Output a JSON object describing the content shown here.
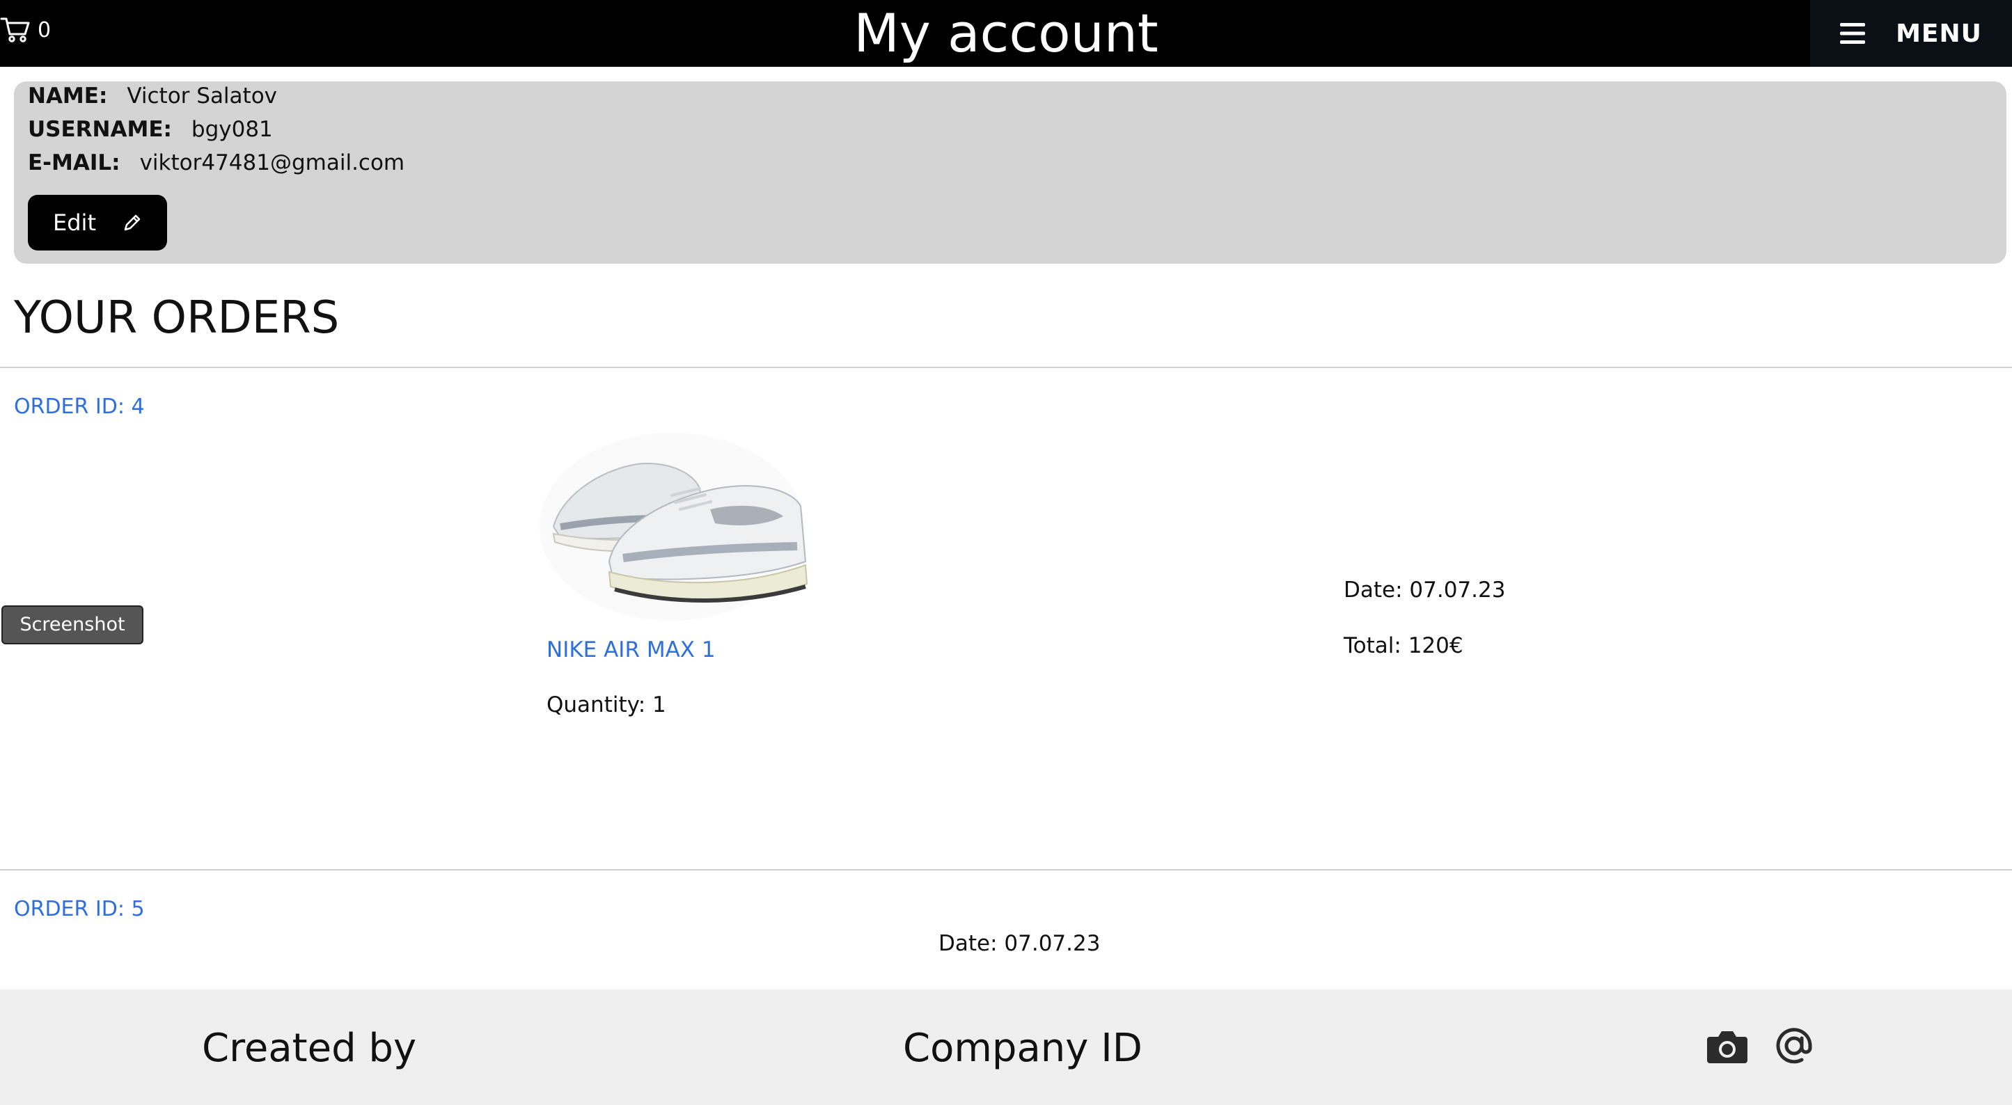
{
  "header": {
    "cart_count": "0",
    "title": "My account",
    "menu_label": "MENU"
  },
  "profile": {
    "name_label": "NAME:",
    "name_value": "Victor Salatov",
    "username_label": "USERNAME:",
    "username_value": "bgy081",
    "email_label": "E-MAIL:",
    "email_value": "viktor47481@gmail.com",
    "edit_label": "Edit"
  },
  "orders": {
    "heading": "YOUR ORDERS",
    "list": [
      {
        "id_label": "ORDER ID: 4",
        "product_name": "NIKE AIR MAX 1",
        "quantity": "Quantity: 1",
        "date": "Date: 07.07.23",
        "total": "Total: 120€"
      },
      {
        "id_label": "ORDER ID: 5",
        "date": "Date: 07.07.23"
      }
    ]
  },
  "overlay": {
    "screenshot_label": "Screenshot"
  },
  "footer": {
    "created_by": "Created by",
    "company_id": "Company ID",
    "icons": [
      "camera-icon",
      "at-sign-icon"
    ]
  },
  "colors": {
    "header_bg": "#000000",
    "link_blue": "#2f6fdc",
    "profile_bg": "#d4d4d4",
    "footer_bg": "#efefef"
  }
}
